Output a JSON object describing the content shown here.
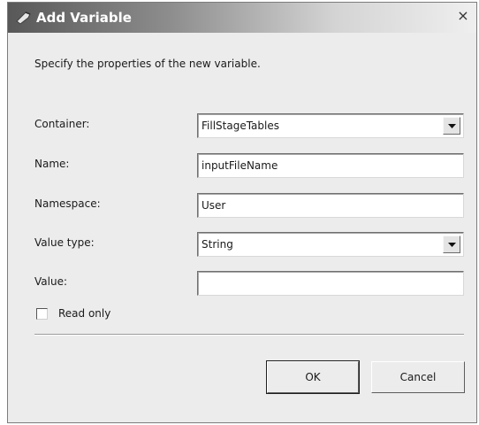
{
  "window": {
    "title": "Add Variable",
    "close_glyph": "×",
    "icon": "variable-icon"
  },
  "instructions": "Specify the properties of the new variable.",
  "form": {
    "container": {
      "label": "Container:",
      "value": "FillStageTables"
    },
    "name": {
      "label": "Name:",
      "value": "inputFileName"
    },
    "namespace": {
      "label": "Namespace:",
      "value": "User"
    },
    "value_type": {
      "label": "Value type:",
      "value": "String"
    },
    "value": {
      "label": "Value:",
      "value": ""
    },
    "read_only": {
      "label": "Read only",
      "checked": false
    }
  },
  "buttons": {
    "ok": "OK",
    "cancel": "Cancel"
  }
}
